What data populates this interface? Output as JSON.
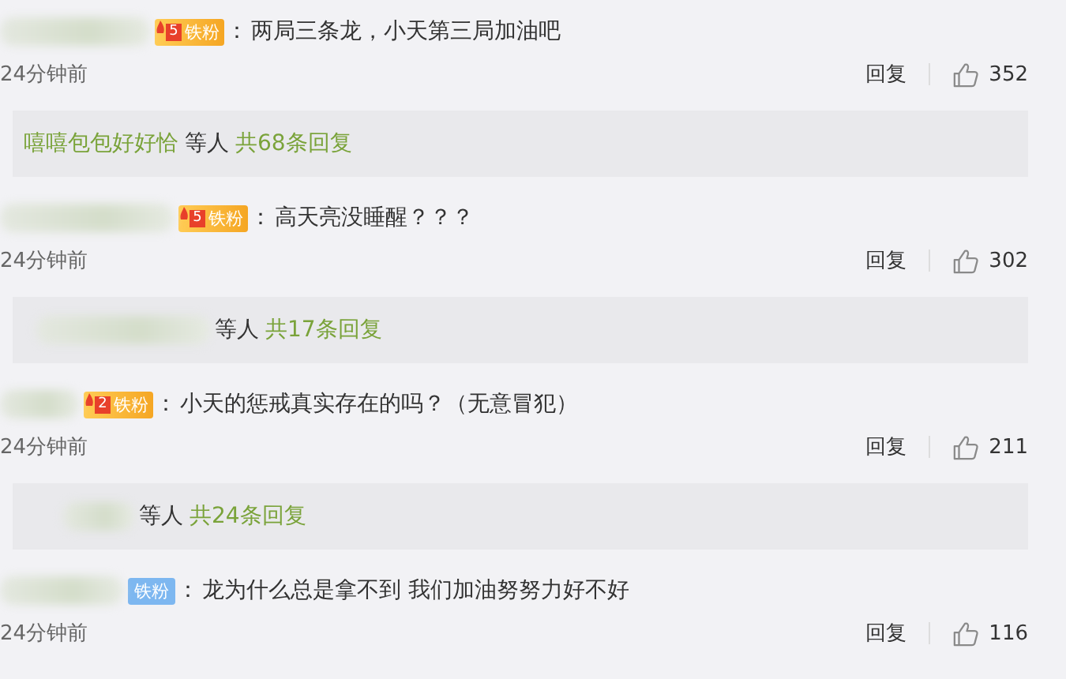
{
  "comments": [
    {
      "badge": {
        "kind": "gold",
        "level": "5",
        "label": "铁粉"
      },
      "colon": "：",
      "text": "两局三条龙，小天第三局加油吧",
      "time": "24分钟前",
      "reply": "回复",
      "likes": "352",
      "thread": {
        "kind": "named",
        "name": "嘻嘻包包好好恰",
        "others": "等人",
        "count": "共68条回复"
      }
    },
    {
      "badge": {
        "kind": "gold",
        "level": "5",
        "label": "铁粉"
      },
      "colon": "：",
      "text": "高天亮没睡醒？？？",
      "time": "24分钟前",
      "reply": "回复",
      "likes": "302",
      "thread": {
        "kind": "blurred",
        "others": "等人",
        "count": "共17条回复"
      }
    },
    {
      "badge": {
        "kind": "gold",
        "level": "2",
        "label": "铁粉"
      },
      "colon": "：",
      "text": "小天的惩戒真实存在的吗？（无意冒犯）",
      "time": "24分钟前",
      "reply": "回复",
      "likes": "211",
      "thread": {
        "kind": "blurred",
        "others": "等人",
        "count": "共24条回复"
      }
    },
    {
      "badge": {
        "kind": "blue",
        "label": "铁粉"
      },
      "colon": "：",
      "text": "龙为什么总是拿不到 我们加油努努力好不好",
      "time": "24分钟前",
      "reply": "回复",
      "likes": "116"
    }
  ]
}
